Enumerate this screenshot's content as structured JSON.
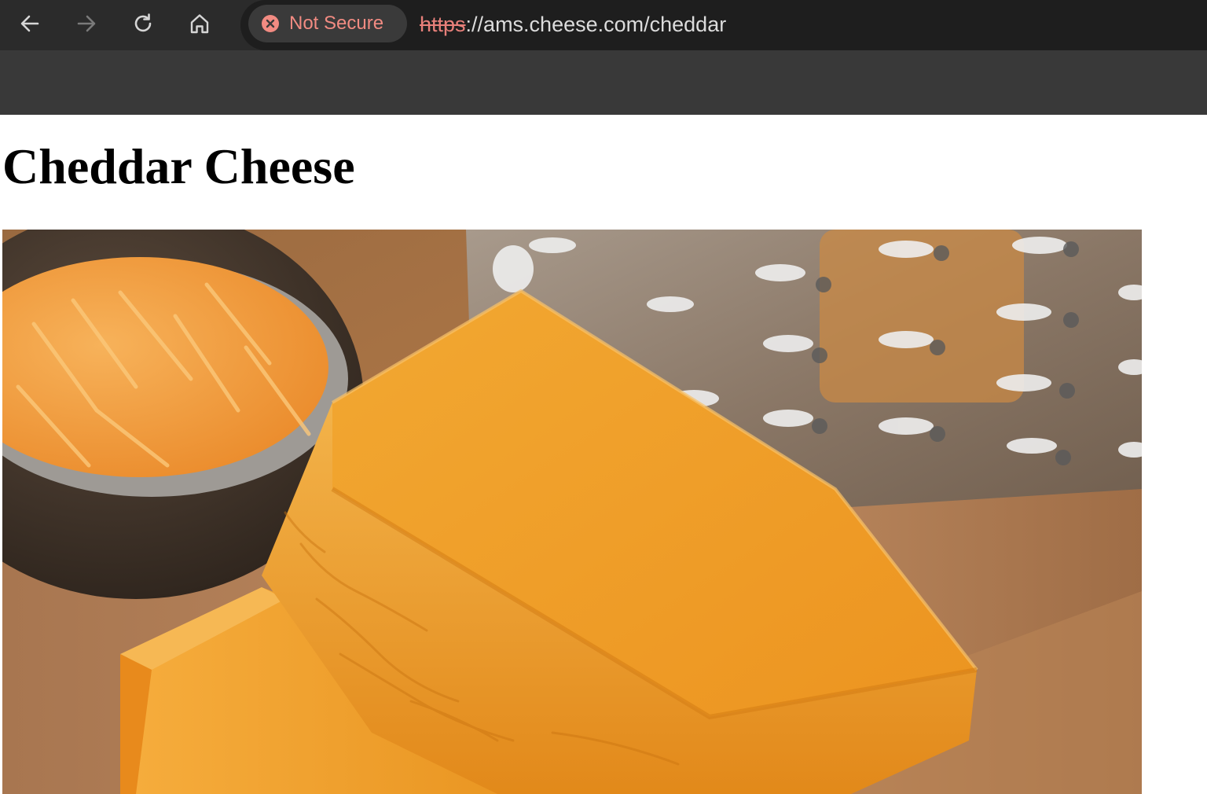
{
  "browser": {
    "nav": {
      "back_icon": "arrow-left-icon",
      "forward_icon": "arrow-right-icon",
      "reload_icon": "reload-icon",
      "home_icon": "home-icon"
    },
    "security": {
      "label": "Not Secure",
      "icon": "x-circle-icon",
      "color": "#f28b82"
    },
    "url": {
      "scheme": "https",
      "rest": "://ams.cheese.com/cheddar"
    }
  },
  "page": {
    "title": "Cheddar Cheese",
    "image_label": "Cheddar cheese photo"
  },
  "colors": {
    "chrome_background": "#393939",
    "toolbar_background": "#2b2b2b",
    "urlbar_background": "#1e1e1e",
    "cheese_orange": "#f0a12a"
  }
}
